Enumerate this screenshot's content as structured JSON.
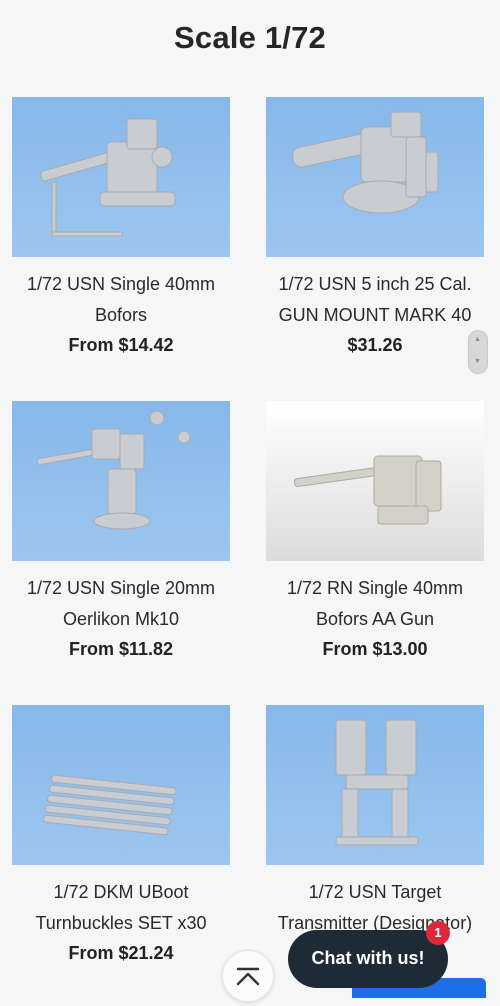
{
  "page": {
    "title": "Scale 1/72"
  },
  "products": [
    {
      "line1": "1/72 USN Single 40mm",
      "line2": "Bofors",
      "price": "From $14.42"
    },
    {
      "line1": "1/72 USN 5 inch 25 Cal.",
      "line2": "GUN MOUNT MARK 40",
      "price": "$31.26"
    },
    {
      "line1": "1/72 USN Single 20mm",
      "line2": "Oerlikon Mk10",
      "price": "From $11.82"
    },
    {
      "line1": "1/72 RN Single 40mm",
      "line2": "Bofors AA Gun",
      "price": "From $13.00"
    },
    {
      "line1": "1/72 DKM UBoot",
      "line2": "Turnbuckles SET x30",
      "price": "From $21.24"
    },
    {
      "line1": "1/72 USN Target",
      "line2": "Transmitter (Designator)",
      "price": ""
    }
  ],
  "chat": {
    "label": "Chat with us!",
    "badge": "1"
  },
  "icons": {
    "scroll_top": "chevron-up-bar-icon",
    "scroll_up": "caret-up-icon",
    "scroll_down": "caret-down-icon"
  },
  "colors": {
    "image_background": "#8fbdec",
    "chat_button": "#1e2a36",
    "badge": "#e0263a"
  }
}
